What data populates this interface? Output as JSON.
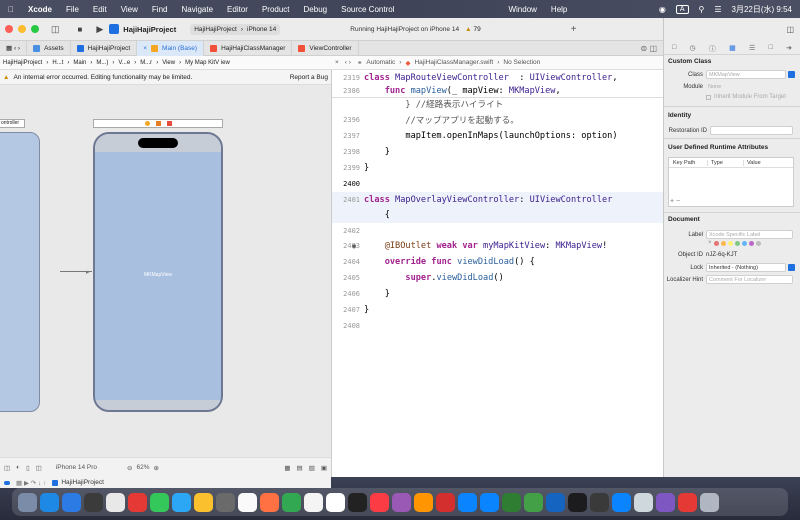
{
  "menubar": {
    "app": "Xcode",
    "items": [
      "File",
      "Edit",
      "View",
      "Find",
      "Navigate",
      "Editor",
      "Product",
      "Debug",
      "Source Control",
      "Window",
      "Help"
    ],
    "input_mode": "A",
    "datetime": "3月22日(水) 9:54"
  },
  "toolbar": {
    "project": "HajiHajiProject",
    "scheme": "HajiHajiProject",
    "device": "iPhone 14",
    "status": "Running HajiHajiProject on iPhone 14",
    "warnings": "79"
  },
  "tabs": [
    "Assets",
    "HajiHajiProject",
    "Main (Base)",
    "HajiHajiClassManager",
    "ViewController"
  ],
  "left_breadcrumb": [
    "HajiHajiProject",
    "H...t",
    "Main",
    "M...)",
    "V...e",
    "M...r",
    "View",
    "My Map KitV iew"
  ],
  "warning": {
    "text": "An internal error occurred. Editing functionality may be limited.",
    "action": "Report a Bug"
  },
  "canvas": {
    "left_label": "ontroller",
    "map_label": "MKMapView",
    "device": "iPhone 14 Pro",
    "zoom": "62%"
  },
  "right_breadcrumb": [
    "Automatic",
    "HajiHajiClassManager.swift",
    "No Selection"
  ],
  "code": {
    "lines": [
      {
        "n": "2319",
        "parts": [
          [
            "kw",
            "class "
          ],
          [
            "ty",
            "MapRouteViewController"
          ],
          [
            "",
            "  : "
          ],
          [
            "ty",
            "UIViewController"
          ],
          [
            "",
            ","
          ]
        ]
      },
      {
        "n": "2386",
        "parts": [
          [
            "",
            "    "
          ],
          [
            "kw",
            "func "
          ],
          [
            "fn",
            "mapView"
          ],
          [
            "",
            "(_ mapView: "
          ],
          [
            "ty",
            "MKMapView"
          ],
          [
            "",
            ","
          ]
        ]
      },
      {
        "n": "",
        "parts": [
          [
            "cm",
            "        } //経路表示ハイライト"
          ]
        ]
      },
      {
        "n": "2396",
        "parts": [
          [
            "cm",
            "        //マップアプリを起動する。"
          ]
        ]
      },
      {
        "n": "2397",
        "parts": [
          [
            "",
            "        mapItem.openInMaps(launchOptions: option)"
          ]
        ]
      },
      {
        "n": "2398",
        "parts": [
          [
            "",
            "    }"
          ]
        ]
      },
      {
        "n": "2399",
        "parts": [
          [
            "",
            "}"
          ]
        ]
      },
      {
        "n": "2400",
        "parts": []
      },
      {
        "n": "2401",
        "parts": [
          [
            "kw",
            "class "
          ],
          [
            "ty",
            "MapOverlayViewController"
          ],
          [
            "",
            ": "
          ],
          [
            "ty",
            "UIViewController"
          ]
        ]
      },
      {
        "n": "",
        "parts": [
          [
            "",
            "    {"
          ]
        ]
      },
      {
        "n": "2402",
        "parts": []
      },
      {
        "n": "2403",
        "parts": [
          [
            "",
            "    "
          ],
          [
            "at",
            "@IBOutlet "
          ],
          [
            "kw",
            "weak var "
          ],
          [
            "ty",
            "myMapKitView"
          ],
          [
            "",
            ": "
          ],
          [
            "ty",
            "MKMapView"
          ],
          [
            "",
            "!"
          ]
        ]
      },
      {
        "n": "2404",
        "parts": [
          [
            "",
            "    "
          ],
          [
            "kw",
            "override func "
          ],
          [
            "fn",
            "viewDidLoad"
          ],
          [
            "",
            "() {"
          ]
        ]
      },
      {
        "n": "2405",
        "parts": [
          [
            "",
            "        "
          ],
          [
            "kw",
            "super"
          ],
          [
            "",
            "."
          ],
          [
            "fn",
            "viewDidLoad"
          ],
          [
            "",
            "()"
          ]
        ]
      },
      {
        "n": "2406",
        "parts": [
          [
            "",
            "    }"
          ]
        ]
      },
      {
        "n": "2407",
        "parts": [
          [
            "",
            "}"
          ]
        ]
      },
      {
        "n": "2408",
        "parts": []
      }
    ]
  },
  "inspector": {
    "custom_class_title": "Custom Class",
    "class_label": "Class",
    "class_value": "MKMapView",
    "module_label": "Module",
    "module_value": "None",
    "inherit_label": "Inherit Module From Target",
    "identity_title": "Identity",
    "restoration_label": "Restoration ID",
    "udra_title": "User Defined Runtime Attributes",
    "udra_cols": [
      "Key Path",
      "Type",
      "Value"
    ],
    "document_title": "Document",
    "label_label": "Label",
    "label_placeholder": "Xcode Specific Label",
    "object_id_label": "Object ID",
    "object_id_value": "nJZ-6q-KJT",
    "lock_label": "Lock",
    "lock_value": "Inherited - (Nothing)",
    "localizer_label": "Localizer Hint",
    "localizer_placeholder": "Comment For Localizer"
  },
  "run_bar": "HajiHajiProject",
  "dock": {
    "colors": [
      "#7a8ca8",
      "#1e88e5",
      "#2c7be5",
      "#3b3b3b",
      "#e8e8e8",
      "#e53935",
      "#34c759",
      "#2ba7f5",
      "#fbc02d",
      "#6a6a6a",
      "#fafafa",
      "#ff7043",
      "#33a852",
      "#f4f4f4",
      "#ffffff",
      "#222",
      "#fc3c44",
      "#9b59b6",
      "#ff9500",
      "#d32f2f",
      "#0a84ff",
      "#0a84ff",
      "#2e7d32",
      "#43a047",
      "#1565c0",
      "#1c1c1e",
      "#3a3a3a",
      "#0a84ff",
      "#cfd8dc",
      "#7e57c2",
      "#e53935",
      "#b0b7c3"
    ]
  }
}
